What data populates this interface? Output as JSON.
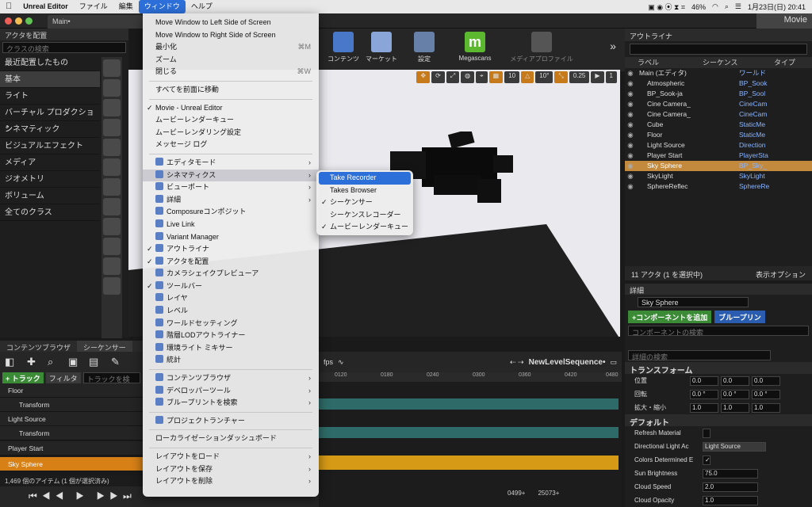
{
  "menubar": {
    "apple": "",
    "app": "Unreal Editor",
    "items": [
      "ファイル",
      "編集",
      "ウィンドウ",
      "ヘルプ"
    ],
    "active_index": 2,
    "battery": "46%",
    "datetime": "1月23日(日)  20:41"
  },
  "window": {
    "tab": "Main•",
    "badge": "Movie"
  },
  "place_actors": {
    "title": "アクタを配置",
    "search_placeholder": "クラスの検索",
    "categories": [
      "最近配置したもの",
      "基本",
      "ライト",
      "バーチャル プロダクション",
      "シネマティック",
      "ビジュアルエフェクト",
      "メディア",
      "ジオメトリ",
      "ボリューム",
      "全てのクラス"
    ],
    "selected_index": 1
  },
  "toolbar": {
    "buttons": [
      "コンテンツ",
      "マーケット",
      "設定",
      "Megascans",
      "メディアプロファイル"
    ]
  },
  "viewport": {
    "grid": "10",
    "angle": "10°",
    "scale": "0.25",
    "camera_speed": "1"
  },
  "outliner": {
    "title": "アウトライナ",
    "cols": [
      "ラベル",
      "シーケンス",
      "タイプ"
    ],
    "rows": [
      {
        "name": "Main (エディタ)",
        "type": "ワールド",
        "level": 0
      },
      {
        "name": "Atmospheric",
        "type": "BP_Sook",
        "level": 1
      },
      {
        "name": "BP_Sook-ja",
        "type": "BP_Sool",
        "level": 1
      },
      {
        "name": "Cine Camera_",
        "type": "CineCam",
        "level": 1
      },
      {
        "name": "Cine Camera_",
        "type": "CineCam",
        "level": 1
      },
      {
        "name": "Cube",
        "type": "StaticMe",
        "level": 1
      },
      {
        "name": "Floor",
        "type": "StaticMe",
        "level": 1
      },
      {
        "name": "Light Source",
        "type": "Direction",
        "level": 1
      },
      {
        "name": "Player Start",
        "type": "PlayerSta",
        "level": 1
      },
      {
        "name": "Sky Sphere",
        "type": "BP_Sky_",
        "level": 1
      },
      {
        "name": "SkyLight",
        "type": "SkyLight",
        "level": 1
      },
      {
        "name": "SphereReflec",
        "type": "SphereRe",
        "level": 1
      }
    ],
    "selected_index": 9,
    "footer_left": "11 アクタ (1 を選択中)",
    "footer_right": "表示オプション"
  },
  "details": {
    "title": "詳細",
    "actor_name": "Sky Sphere",
    "add_component": "+コンポーネントを追加",
    "blueprint": "ブループリン",
    "comp_search": "コンポーネントの検索",
    "detail_search": "詳細の検索",
    "transform": {
      "title": "トランスフォーム",
      "location": {
        "label": "位置",
        "x": "0.0",
        "y": "0.0",
        "z": "0.0"
      },
      "rotation": {
        "label": "回転",
        "x": "0.0 °",
        "y": "0.0 °",
        "z": "0.0 °"
      },
      "scale": {
        "label": "拡大・縮小",
        "x": "1.0",
        "y": "1.0",
        "z": "1.0"
      }
    },
    "default": {
      "title": "デフォルト",
      "refresh": "Refresh Material",
      "dir_light": "Directional Light Ac",
      "dir_light_value": "Light Source",
      "colors_determined": "Colors Determined E",
      "sun_brightness": {
        "label": "Sun Brightness",
        "value": "75.0"
      },
      "cloud_speed": {
        "label": "Cloud Speed",
        "value": "2.0"
      },
      "cloud_opacity": {
        "label": "Cloud Opacity",
        "value": "1.0"
      }
    }
  },
  "sequencer": {
    "tabs": [
      "コンテンツブラウザ",
      "シーケンサー"
    ],
    "track_btn": "+ トラック",
    "filter_btn": "フィルタ",
    "track_search": "トラックを検索",
    "fps": "fps",
    "sequence_name": "NewLevelSequence•",
    "ruler": [
      "0120",
      "0180",
      "0240",
      "0300",
      "0360",
      "0420",
      "0480"
    ],
    "tracks": [
      "Floor",
      "Transform",
      "Light Source",
      "Transform",
      "Player Start",
      "Sky Sphere"
    ],
    "status": "1,469 個のアイテム (1 個が選択済み)",
    "frame": "0499+",
    "end": "25073+"
  },
  "window_menu": {
    "items": [
      {
        "label": "Move Window to Left Side of Screen"
      },
      {
        "label": "Move Window to Right Side of Screen"
      },
      {
        "label": "最小化",
        "shortcut": "⌘M"
      },
      {
        "label": "ズーム"
      },
      {
        "label": "閉じる",
        "shortcut": "⌘W"
      },
      {
        "sep": true
      },
      {
        "label": "すべてを前面に移動"
      },
      {
        "sep": true
      },
      {
        "label": "Movie - Unreal Editor",
        "check": true
      },
      {
        "label": "ムービーレンダーキュー"
      },
      {
        "label": "ムービーレンダリング設定"
      },
      {
        "label": "メッセージ ログ"
      },
      {
        "sep": true
      },
      {
        "label": "エディタモード",
        "icon": true,
        "submenu": true
      },
      {
        "label": "シネマティクス",
        "icon": true,
        "submenu": true,
        "hl": true
      },
      {
        "label": "ビューポート",
        "icon": true,
        "submenu": true
      },
      {
        "label": "詳細",
        "icon": true,
        "submenu": true
      },
      {
        "label": "Composureコンポジット",
        "icon": true
      },
      {
        "label": "Live Link",
        "icon": true
      },
      {
        "label": "Variant Manager",
        "icon": true
      },
      {
        "label": "アウトライナ",
        "icon": true,
        "check": true
      },
      {
        "label": "アクタを配置",
        "icon": true,
        "check": true
      },
      {
        "label": "カメラシェイクプレビューア",
        "icon": true
      },
      {
        "label": "ツールバー",
        "icon": true,
        "check": true
      },
      {
        "label": "レイヤ",
        "icon": true
      },
      {
        "label": "レベル",
        "icon": true
      },
      {
        "label": "ワールドセッティング",
        "icon": true
      },
      {
        "label": "階層LODアウトライナー",
        "icon": true
      },
      {
        "label": "環境ライト ミキサー",
        "icon": true
      },
      {
        "label": "統計",
        "icon": true
      },
      {
        "sep": true
      },
      {
        "label": "コンテンツブラウザ",
        "icon": true,
        "submenu": true
      },
      {
        "label": "デベロッパーツール",
        "icon": true,
        "submenu": true
      },
      {
        "label": "ブループリントを検索",
        "icon": true,
        "submenu": true
      },
      {
        "sep": true
      },
      {
        "label": "プロジェクトランチャー",
        "icon": true
      },
      {
        "sep": true
      },
      {
        "label": "ローカライゼーションダッシュボード"
      },
      {
        "sep": true
      },
      {
        "label": "レイアウトをロード",
        "submenu": true
      },
      {
        "label": "レイアウトを保存",
        "submenu": true
      },
      {
        "label": "レイアウトを削除",
        "submenu": true
      }
    ]
  },
  "submenu": {
    "items": [
      {
        "label": "Take Recorder",
        "hl": true
      },
      {
        "label": "Takes Browser"
      },
      {
        "label": "シーケンサー",
        "check": true
      },
      {
        "label": "シーケンスレコーダー"
      },
      {
        "label": "ムービーレンダーキュー",
        "check": true
      }
    ]
  }
}
